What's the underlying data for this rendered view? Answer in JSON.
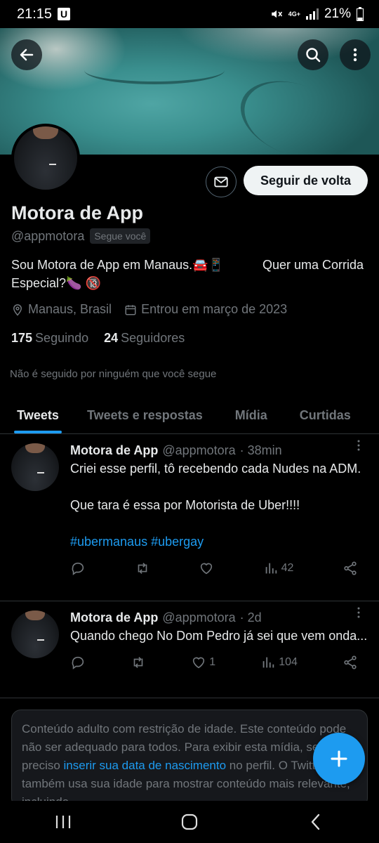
{
  "status_bar": {
    "time": "21:15",
    "notification_badge": "U",
    "network": "4G+",
    "battery": "21%"
  },
  "profile": {
    "name": "Motora de App",
    "handle": "@appmotora",
    "follows_you_badge": "Segue você",
    "follow_back_label": "Seguir de volta",
    "bio": "Sou Motora de App em Manaus.🚘📱           Quer uma Corrida Especial?🍆 🔞",
    "location": "Manaus, Brasil",
    "joined": "Entrou em março de 2023",
    "following_count": "175",
    "following_label": "Seguindo",
    "followers_count": "24",
    "followers_label": "Seguidores",
    "not_followed_note": "Não é seguido por ninguém que você segue"
  },
  "tabs": [
    {
      "label": "Tweets",
      "active": true
    },
    {
      "label": "Tweets e respostas",
      "active": false
    },
    {
      "label": "Mídia",
      "active": false
    },
    {
      "label": "Curtidas",
      "active": false
    }
  ],
  "tweets": [
    {
      "name": "Motora de App",
      "handle": "@appmotora",
      "time": "· 38min",
      "text_1": "Criei esse perfil, tô recebendo cada Nudes na ADM.",
      "text_2": "Que tara é essa por Motorista de Uber!!!!",
      "hashtags": "#ubermanaus #ubergay",
      "likes": "",
      "views": "42"
    },
    {
      "name": "Motora de App",
      "handle": "@appmotora",
      "time": "· 2d",
      "text_1": "Quando chego No Dom Pedro já sei que vem onda...",
      "likes": "1",
      "views": "104"
    }
  ],
  "warning": {
    "text_1": "Conteúdo adulto com restrição de idade. Este conteúdo pode não ser adequado para todos. Para exibir esta mídia, será preciso ",
    "link": "inserir sua data de nascimento",
    "text_2": " no perfil. O Twitter também usa sua idade para mostrar conteúdo mais relevante, incluindo"
  },
  "colors": {
    "accent": "#1d9bf0",
    "background": "#000000",
    "muted": "#71767b",
    "text": "#e7e9ea"
  },
  "icons": [
    "back-arrow-icon",
    "search-icon",
    "more-vertical-icon",
    "mail-icon",
    "location-icon",
    "calendar-icon",
    "reply-icon",
    "retweet-icon",
    "like-icon",
    "views-icon",
    "share-icon",
    "plus-icon"
  ]
}
